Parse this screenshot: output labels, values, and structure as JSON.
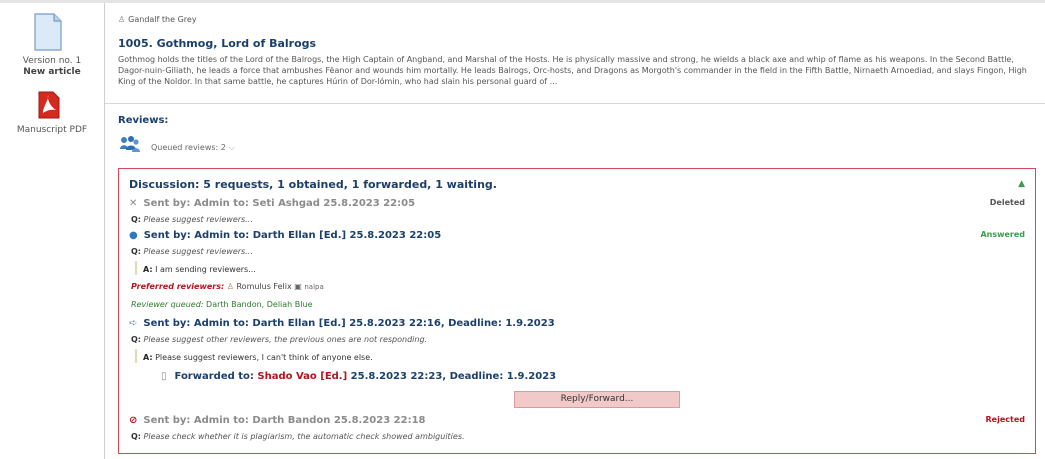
{
  "sidebar": {
    "version_label": "Version no. 1",
    "new_article_label": "New article",
    "pdf_label": "Manuscript PDF"
  },
  "article": {
    "author": "Gandalf the Grey",
    "title": "1005. Gothmog, Lord of Balrogs",
    "abstract": "Gothmog holds the titles of the Lord of the Balrogs, the High Captain of Angband, and Marshal of the Hosts. He is physically massive and strong, he wields a black axe and whip of flame as his weapons. In the Second Battle, Dagor-nuin-Giliath, he leads a force that ambushes Fëanor and wounds him mortally. He leads Balrogs, Orc-hosts, and Dragons as Morgoth's commander in the field in the Fifth Battle, Nirnaeth Arnoediad, and slays Fingon, High King of the Noldor. In that same battle, he captures Húrin of Dor-lómin, who had slain his personal guard of ..."
  },
  "reviews": {
    "heading": "Reviews:",
    "queued_label": "Queued reviews: 2"
  },
  "discussion": {
    "heading": "Discussion: 5 requests, 1 obtained, 1 forwarded, 1 waiting.",
    "entries": [
      {
        "sent": "Sent by: Admin to: Seti Ashgad 25.8.2023 22:05",
        "question": "Please suggest reviewers...",
        "status": "Deleted"
      },
      {
        "sent": "Sent by: Admin to: Darth Ellan [Ed.] 25.8.2023 22:05",
        "question": "Please suggest reviewers...",
        "answer": "I am sending reviewers...",
        "status": "Answered",
        "preferred_label": "Preferred reviewers:",
        "preferred_value": "Romulus Felix",
        "preferred_extra": "nalpa",
        "queued_label": "Reviewer queued:",
        "queued_value": "Darth Bandon, Deliah Blue"
      },
      {
        "sent": "Sent by: Admin to: Darth Ellan [Ed.] 25.8.2023 22:16, Deadline: 1.9.2023",
        "question": "Please suggest other reviewers, the previous ones are not responding.",
        "answer": "Please suggest reviewers, I can't think of anyone else.",
        "forward_prefix": "Forwarded to:",
        "forward_to": "Shado Vao [Ed.]",
        "forward_rest": "25.8.2023 22:23, Deadline: 1.9.2023"
      },
      {
        "sent": "Sent by: Admin to: Darth Bandon 25.8.2023 22:18",
        "question": "Please check whether it is plagiarism, the automatic check showed ambiguities.",
        "status": "Rejected"
      }
    ],
    "q_prefix": "Q:",
    "a_prefix": "A:",
    "reply_button": "Reply/Forward..."
  },
  "colors": {
    "heading_blue": "#1b3f6b",
    "deleted_gray": "#8b8b8b",
    "answered_green": "#3c9a4c",
    "rejected_red": "#b4141e",
    "box_border": "#d04a5a"
  },
  "icons": [
    "document-icon",
    "pdf-icon",
    "user-icon",
    "reviewers-icon",
    "chevron-down-icon",
    "collapse-up-icon",
    "delete-x-icon",
    "info-icon",
    "forward-arrow-icon",
    "forwarded-icon",
    "rejected-icon"
  ]
}
